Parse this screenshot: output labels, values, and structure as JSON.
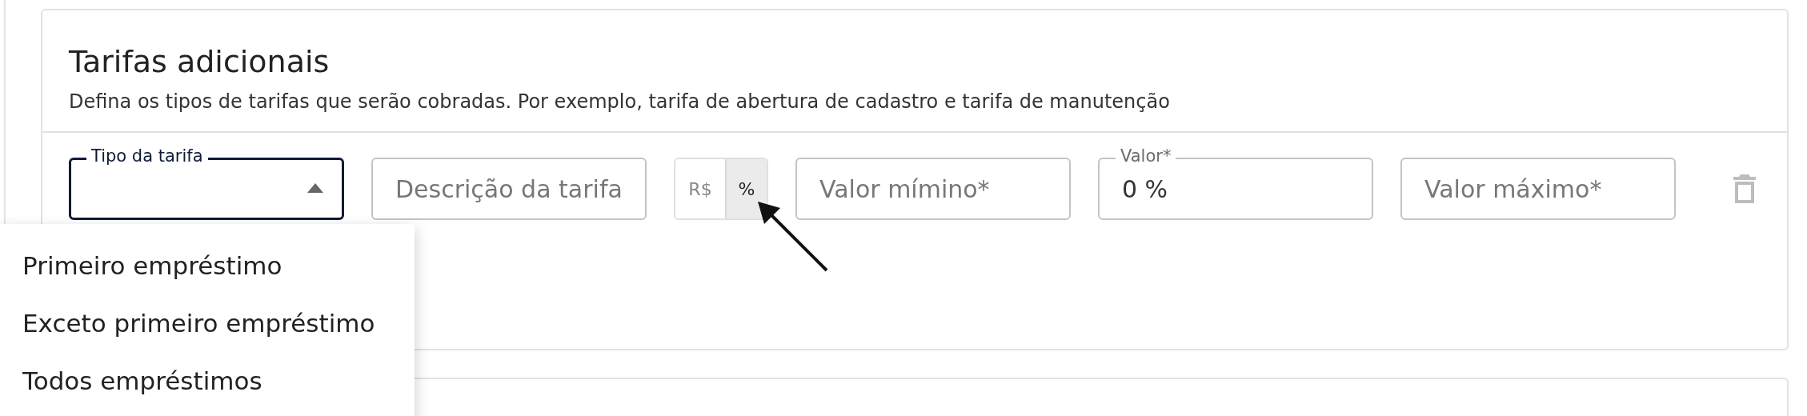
{
  "section": {
    "title": "Tarifas adicionais",
    "description": "Defina os tipos de tarifas que serão cobradas. Por exemplo, tarifa de abertura de cadastro e tarifa de manutenção"
  },
  "fee_row": {
    "type_select": {
      "label": "Tipo da tarifa",
      "expanded": true
    },
    "description_field": {
      "placeholder": "Descrição da tarifa"
    },
    "unit_toggle": [
      {
        "label": "R$",
        "selected": false
      },
      {
        "label": "%",
        "selected": true
      }
    ],
    "min_field": {
      "placeholder": "Valor mímino*"
    },
    "value_field": {
      "label": "Valor*",
      "value": "0 %"
    },
    "max_field": {
      "placeholder": "Valor máximo*"
    }
  },
  "dropdown_menu": [
    {
      "label": "Primeiro empréstimo"
    },
    {
      "label": "Exceto primeiro empréstimo"
    },
    {
      "label": "Todos empréstimos"
    }
  ]
}
